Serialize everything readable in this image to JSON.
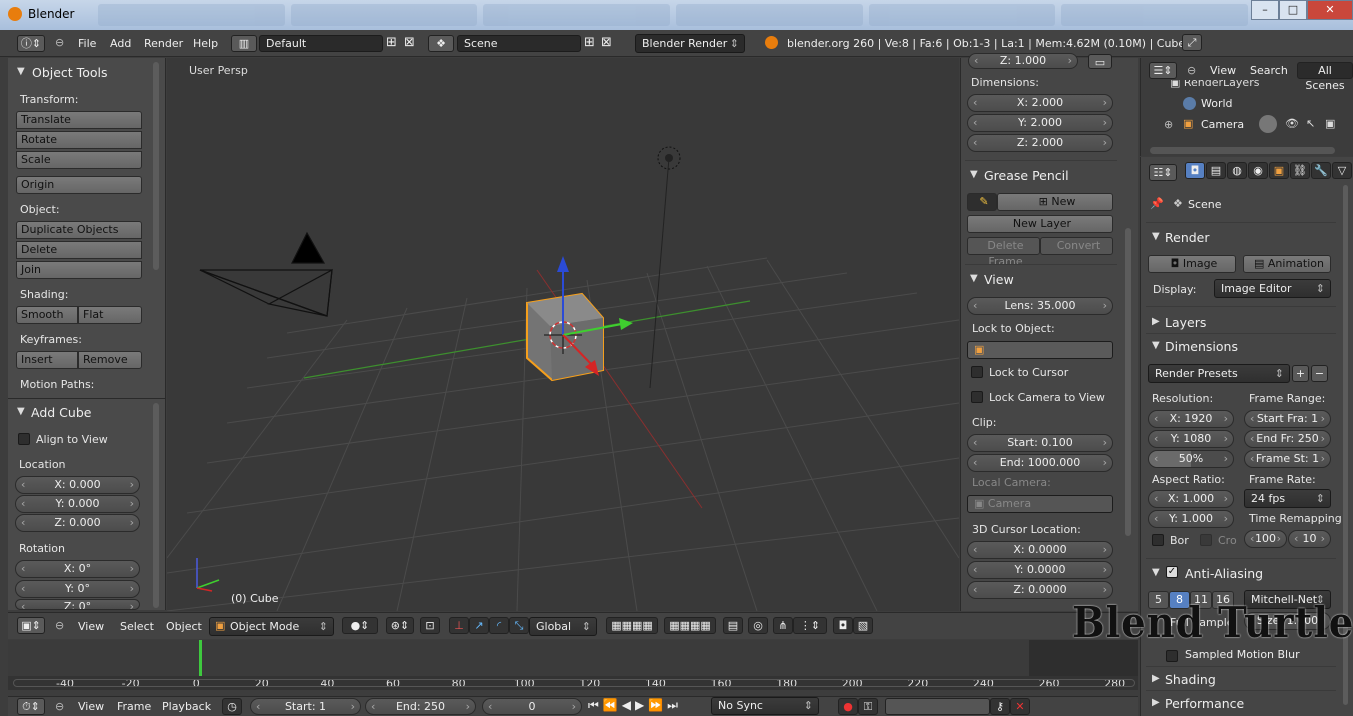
{
  "window": {
    "title": "Blender"
  },
  "topbar": {
    "menus": [
      "File",
      "Add",
      "Render",
      "Help"
    ],
    "layout": "Default",
    "scene": "Scene",
    "engine": "Blender Render",
    "stats": "blender.org 260 | Ve:8 | Fa:6 | Ob:1-3 | La:1 | Mem:4.62M (0.10M) | Cube"
  },
  "tools": {
    "title": "Object Tools",
    "transform_label": "Transform:",
    "translate": "Translate",
    "rotate": "Rotate",
    "scale": "Scale",
    "origin": "Origin",
    "object_label": "Object:",
    "duplicate": "Duplicate Objects",
    "delete": "Delete",
    "join": "Join",
    "shading_label": "Shading:",
    "smooth": "Smooth",
    "flat": "Flat",
    "keyframes_label": "Keyframes:",
    "insert": "Insert",
    "remove": "Remove",
    "motion_label": "Motion Paths:"
  },
  "add_cube": {
    "title": "Add Cube",
    "align": "Align to View",
    "location_label": "Location",
    "loc_x": "X: 0.000",
    "loc_y": "Y: 0.000",
    "loc_z": "Z: 0.000",
    "rotation_label": "Rotation",
    "rot_x": "X: 0°",
    "rot_y": "Y: 0°",
    "rot_z": "Z: 0°"
  },
  "viewport": {
    "view_name": "User Persp",
    "object_label": "(0) Cube"
  },
  "props": {
    "z_top": "Z: 1.000",
    "dimensions_label": "Dimensions:",
    "dim_x": "X: 2.000",
    "dim_y": "Y: 2.000",
    "dim_z": "Z: 2.000",
    "grease_title": "Grease Pencil",
    "new": "New",
    "new_layer": "New Layer",
    "delete_frame": "Delete Frame",
    "convert": "Convert",
    "view_title": "View",
    "lens": "Lens: 35.000",
    "lock_object": "Lock to Object:",
    "lock_cursor": "Lock to Cursor",
    "lock_camera": "Lock Camera to View",
    "clip_label": "Clip:",
    "clip_start": "Start: 0.100",
    "clip_end": "End: 1000.000",
    "local_camera": "Local Camera:",
    "camera_field": "Camera",
    "cursor_label": "3D Cursor Location:",
    "cur_x": "X: 0.0000",
    "cur_y": "Y: 0.0000",
    "cur_z": "Z: 0.0000"
  },
  "viewheader": {
    "menus": [
      "View",
      "Select",
      "Object"
    ],
    "mode": "Object Mode",
    "orientation": "Global"
  },
  "timeline": {
    "ticks": [
      "-40",
      "-20",
      "0",
      "20",
      "40",
      "60",
      "80",
      "100",
      "120",
      "140",
      "160",
      "180",
      "200",
      "220",
      "240",
      "260",
      "280"
    ],
    "menus": [
      "View",
      "Frame",
      "Playback"
    ],
    "start": "Start: 1",
    "end": "End: 250",
    "current": "0",
    "sync": "No Sync"
  },
  "outliner": {
    "menus": [
      "View",
      "Search"
    ],
    "scenes": "All Scenes",
    "render_layers": "RenderLayers",
    "world": "World",
    "camera": "Camera"
  },
  "render": {
    "scene": "Scene",
    "render_title": "Render",
    "image": "Image",
    "animation": "Animation",
    "display_label": "Display:",
    "display": "Image Editor",
    "layers": "Layers",
    "dimensions": "Dimensions",
    "presets": "Render Presets",
    "resolution_label": "Resolution:",
    "res_x": "X: 1920",
    "res_y": "Y: 1080",
    "res_pct": "50%",
    "frame_range_label": "Frame Range:",
    "start_fra": "Start Fra: 1",
    "end_fr": "End Fr: 250",
    "frame_st": "Frame St: 1",
    "aspect_label": "Aspect Ratio:",
    "asp_x": "X: 1.000",
    "asp_y": "Y: 1.000",
    "frame_rate_label": "Frame Rate:",
    "fps": "24 fps",
    "time_remap": "Time Remapping",
    "bor": "Bor",
    "cro": "Cro",
    "remap_old": "100",
    "remap_new": "10",
    "aa": "Anti-Aliasing",
    "aa_5": "5",
    "aa_8": "8",
    "aa_11": "11",
    "aa_16": "16",
    "filter": "Mitchell-Net",
    "full_sample": "Full Sample",
    "size": "Size: 1.000",
    "motion_blur": "Sampled Motion Blur",
    "shading": "Shading",
    "performance": "Performance"
  },
  "watermark": "Blend Turtle"
}
